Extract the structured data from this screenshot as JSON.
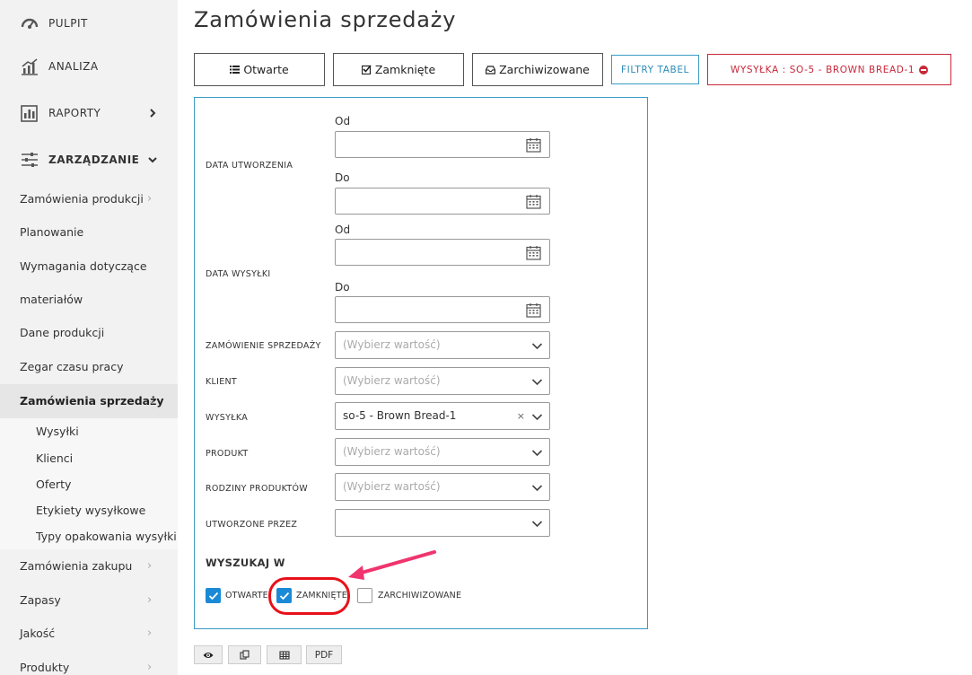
{
  "sidebar": {
    "top": [
      {
        "label": "PULPIT",
        "icon": "gauge-icon"
      },
      {
        "label": "ANALIZA",
        "icon": "chart-icon"
      },
      {
        "label": "RAPORTY",
        "icon": "bar-report-icon"
      },
      {
        "label": "ZARZĄDZANIE",
        "icon": "sliders-icon"
      }
    ],
    "items": [
      {
        "label": "Zamówienia produkcji"
      },
      {
        "label": "Planowanie"
      },
      {
        "label": "Wymagania dotyczące"
      },
      {
        "label": "materiałów"
      },
      {
        "label": "Dane produkcji"
      },
      {
        "label": "Zegar czasu pracy"
      },
      {
        "label": "Zamówienia sprzedaży"
      },
      {
        "label": "Zamówienia zakupu"
      },
      {
        "label": "Zapasy"
      },
      {
        "label": "Jakość"
      },
      {
        "label": "Produkty"
      }
    ],
    "subitems": [
      {
        "label": "Wysyłki"
      },
      {
        "label": "Klienci"
      },
      {
        "label": "Oferty"
      },
      {
        "label": "Etykiety wysyłkowe"
      },
      {
        "label": "Typy opakowania wysyłki"
      }
    ]
  },
  "page": {
    "title": "Zamówienia sprzedaży"
  },
  "toolbar": {
    "open_label": "Otwarte",
    "closed_label": "Zamknięte",
    "archived_label": "Zarchiwizowane",
    "filters_label": "FILTRY TABEL",
    "active_filter_label": "WYSYŁKA : SO-5 - BROWN BREAD-1"
  },
  "filters": {
    "created_date_label": "DATA UTWORZENIA",
    "shipping_date_label": "DATA WYSYŁKI",
    "from_label": "Od",
    "to_label": "Do",
    "sales_order_label": "ZAMÓWIENIE SPRZEDAŻY",
    "client_label": "KLIENT",
    "shipment_label": "WYSYŁKA",
    "product_label": "PRODUKT",
    "product_families_label": "RODZINY PRODUKTÓW",
    "created_by_label": "UTWORZONE PRZEZ",
    "placeholder": "(Wybierz wartość)",
    "shipment_value": "so-5 - Brown Bread-1",
    "clear_glyph": "×"
  },
  "search_in": {
    "title": "WYSZUKAJ W",
    "open": {
      "label": "OTWARTE",
      "checked": true
    },
    "closed": {
      "label": "ZAMKNIĘTE",
      "checked": true
    },
    "archived": {
      "label": "ZARCHIWIZOWANE",
      "checked": false
    }
  },
  "bottom": {
    "pdf_label": "PDF"
  },
  "colors": {
    "accent": "#3a9bc4",
    "danger": "#c8283a",
    "checkbox": "#1b8ad6",
    "annotation": "#f0346e"
  }
}
